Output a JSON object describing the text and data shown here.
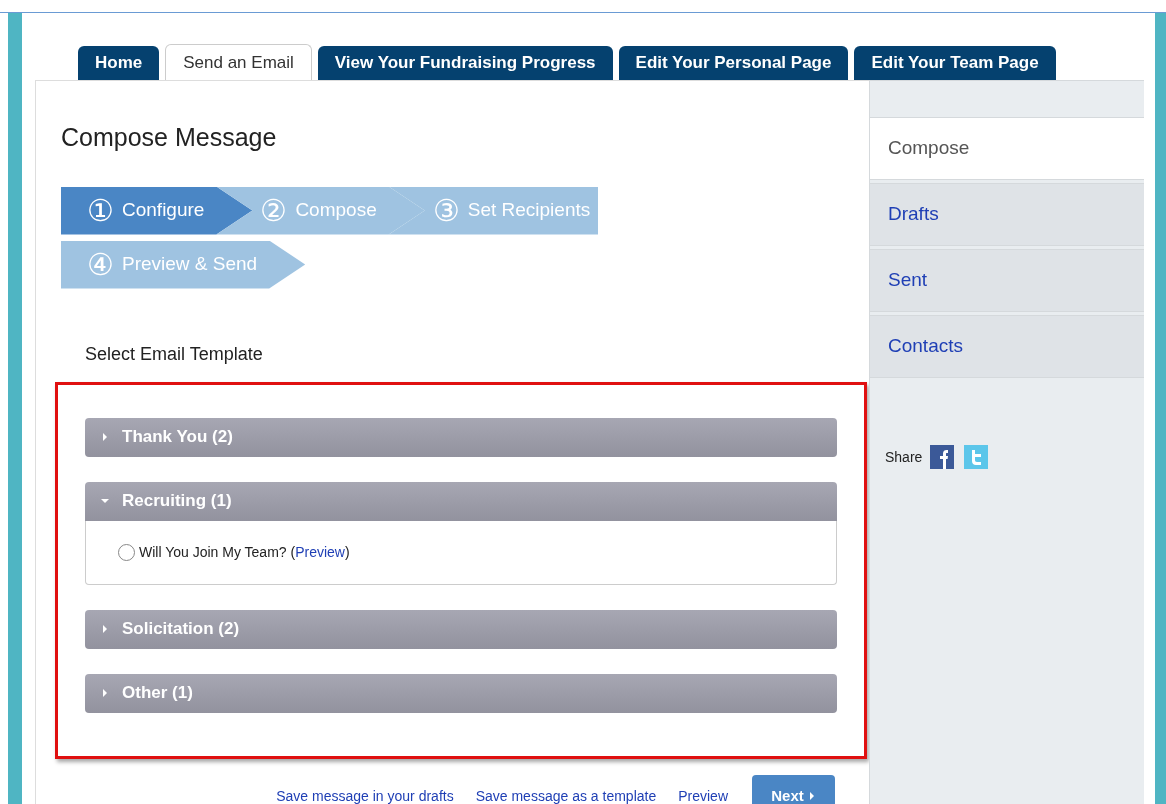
{
  "tabs": [
    {
      "label": "Home",
      "selected": false
    },
    {
      "label": "Send an Email",
      "selected": true
    },
    {
      "label": "View Your Fundraising Progress",
      "selected": false
    },
    {
      "label": "Edit Your Personal Page",
      "selected": false
    },
    {
      "label": "Edit Your Team Page",
      "selected": false
    }
  ],
  "title": "Compose Message",
  "steps": [
    {
      "number": "①",
      "label": "Configure",
      "selected": true
    },
    {
      "number": "②",
      "label": "Compose",
      "selected": false
    },
    {
      "number": "③",
      "label": "Set Recipients",
      "selected": false
    },
    {
      "number": "④",
      "label": "Preview & Send",
      "selected": false
    }
  ],
  "section_label": "Select Email Template",
  "categories": [
    {
      "label": "Thank You (2)",
      "expanded": false
    },
    {
      "label": "Recruiting (1)",
      "expanded": true,
      "templates": [
        {
          "text": "Will You Join My Team? (",
          "link": "Preview",
          "after": ")",
          "selected": false
        }
      ]
    },
    {
      "label": "Solicitation (2)",
      "expanded": false
    },
    {
      "label": "Other (1)",
      "expanded": false
    }
  ],
  "footer": {
    "links": [
      "Save message in your drafts",
      "Save message as a template",
      "Preview"
    ],
    "next_button": "Next"
  },
  "sidebar": {
    "items": [
      {
        "label": "Compose",
        "selected": true
      },
      {
        "label": "Drafts",
        "selected": false
      },
      {
        "label": "Sent",
        "selected": false
      },
      {
        "label": "Contacts",
        "selected": false
      }
    ],
    "share_label": "Share"
  }
}
